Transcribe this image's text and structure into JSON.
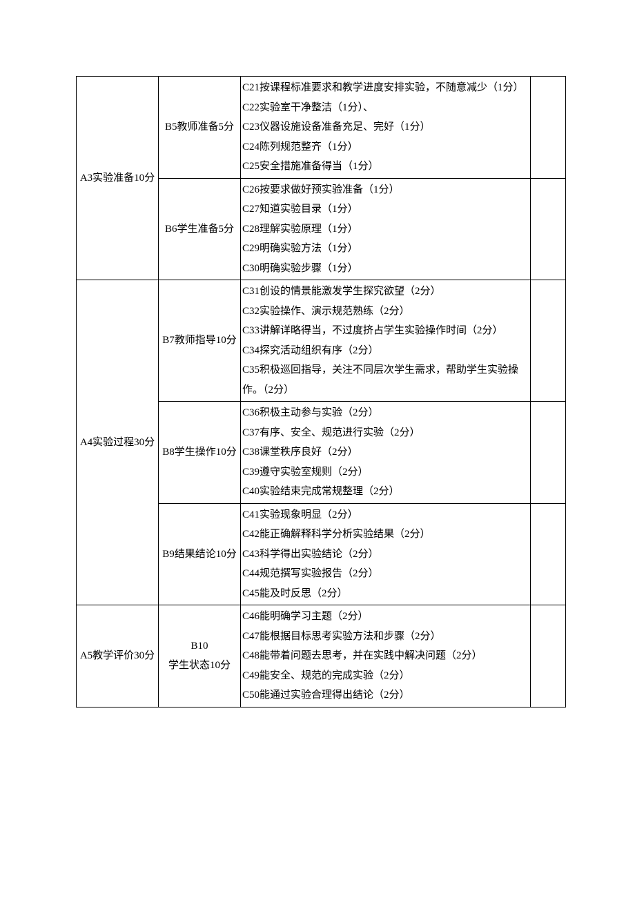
{
  "rows": [
    {
      "a": "A3实验准备10分",
      "b_groups": [
        {
          "b": "B5教师准备5分",
          "c": [
            "C21按课程标准要求和教学进度安排实验，不随意减少（1分）",
            "C22实验室干净整洁（1分）、",
            "C23仪器设施设备准备充足、完好（1分）",
            "C24陈列规范整齐（1分）",
            "C25安全措施准备得当（1分）"
          ]
        },
        {
          "b": "B6学生准备5分",
          "c": [
            "C26按要求做好预实验准备（1分）",
            "C27知道实验目录（1分）",
            "C28理解实验原理（1分）",
            "C29明确实验方法（1分）",
            "C30明确实验步骤（1分）"
          ]
        }
      ]
    },
    {
      "a": "A4实验过程30分",
      "b_groups": [
        {
          "b": "B7教师指导10分",
          "c": [
            "C31创设的情景能激发学生探究欲望（2分）",
            "C32实验操作、演示规范熟练（2分）",
            "C33讲解详略得当，不过度挤占学生实验操作时间（2分）",
            "C34探究活动组织有序（2分）",
            "C35积极巡回指导，关注不同层次学生需求，帮助学生实验操作。（2分）"
          ]
        },
        {
          "b": "B8学生操作10分",
          "c": [
            "C36积极主动参与实验（2分）",
            "C37有序、安全、规范进行实验（2分）",
            "C38课堂秩序良好（2分）",
            "C39遵守实验室规则（2分）",
            "C40实验结束完成常规整理（2分）"
          ]
        },
        {
          "b": "B9结果结论10分",
          "c": [
            "C41实验现象明显（2分）",
            "C42能正确解释科学分析实验结果（2分）",
            "C43科学得出实验结论（2分）",
            "C44规范撰写实验报告（2分）",
            "C45能及时反思（2分）"
          ]
        }
      ]
    },
    {
      "a": "A5教学评价30分",
      "b_groups": [
        {
          "b": "B10\n学生状态10分",
          "c": [
            "C46能明确学习主题（2分）",
            "C47能根据目标思考实验方法和步骤（2分）",
            "C48能带着问题去思考，并在实践中解决问题（2分）",
            "C49能安全、规范的完成实验（2分）",
            "C50能通过实验合理得出结论（2分）"
          ]
        }
      ]
    }
  ]
}
